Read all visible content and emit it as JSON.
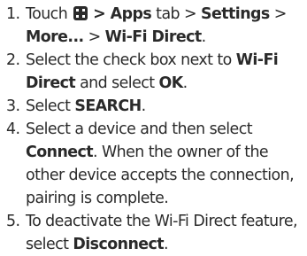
{
  "steps": [
    {
      "number": "1.",
      "touch": "Touch",
      "icon": "apps-grid-icon",
      "apps": "> Apps",
      "tab": "tab >",
      "settings": "Settings",
      "sep1": ">",
      "more": "More...",
      "sep2": ">",
      "wifi_direct": "Wi-Fi Direct",
      "end": "."
    },
    {
      "number": "2.",
      "lead": "Select the check box next to",
      "bold1": "Wi-Fi Direct",
      "mid": "and select",
      "bold2": "OK",
      "end": "."
    },
    {
      "number": "3.",
      "lead": "Select",
      "bold1": "SEARCH",
      "end": "."
    },
    {
      "number": "4.",
      "lead": "Select a device and then select",
      "bold1": "Connect",
      "rest": ". When the owner of the other device accepts the connection, pairing is complete."
    },
    {
      "number": "5.",
      "lead": "To deactivate the Wi-Fi Direct feature, select",
      "bold1": "Disconnect",
      "end": "."
    }
  ]
}
